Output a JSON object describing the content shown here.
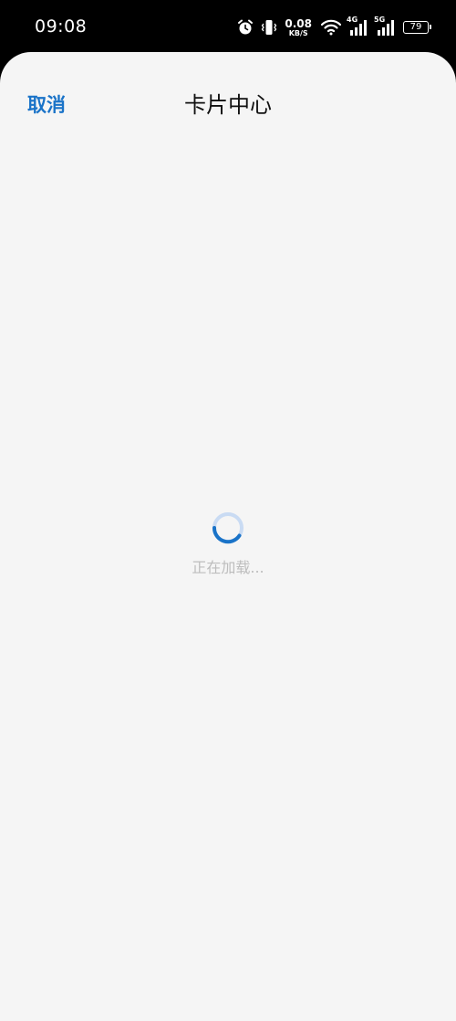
{
  "status_bar": {
    "time": "09:08",
    "net_speed_value": "0.08",
    "net_speed_unit": "KB/S",
    "sim1_gen": "4G",
    "sim2_gen": "5G",
    "battery": "79",
    "icons": [
      "alarm-icon",
      "vibrate-icon",
      "wifi-icon",
      "signal-icon",
      "battery-icon"
    ]
  },
  "header": {
    "cancel_label": "取消",
    "title": "卡片中心"
  },
  "loading": {
    "text": "正在加载..."
  },
  "colors": {
    "accent": "#1a73c8",
    "sheet_bg": "#f5f5f5",
    "status_bg": "#000000",
    "loading_text": "#bdbdbd"
  }
}
